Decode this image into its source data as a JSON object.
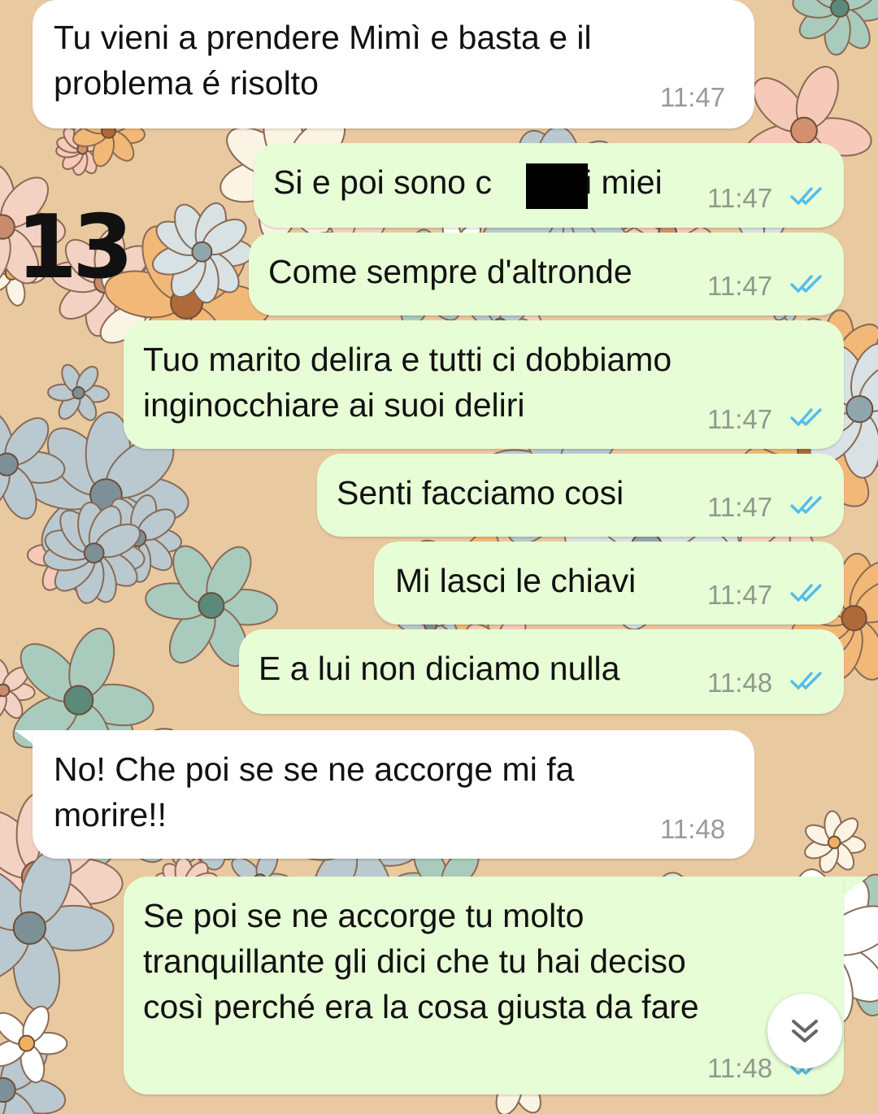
{
  "annotation": {
    "number": "13"
  },
  "messages": [
    {
      "dir": "in",
      "text": "Tu vieni a prendere Mimì e basta e il\nproblema é risolto",
      "time": "11:47"
    },
    {
      "dir": "out",
      "text_before": "Si e poi sono c",
      "text_after": "i miei",
      "time": "11:47",
      "redacted": true
    },
    {
      "dir": "out",
      "text": "Come sempre d'altronde",
      "time": "11:47"
    },
    {
      "dir": "out",
      "text": "Tuo marito delira e tutti ci dobbiamo\ninginocchiare ai suoi deliri",
      "time": "11:47"
    },
    {
      "dir": "out",
      "text": "Senti facciamo cosi",
      "time": "11:47"
    },
    {
      "dir": "out",
      "text": "Mi lasci le chiavi",
      "time": "11:47"
    },
    {
      "dir": "out",
      "text": "E a lui non diciamo nulla",
      "time": "11:48"
    },
    {
      "dir": "in",
      "text": "No! Che poi se se ne accorge mi fa\nmorire!!",
      "time": "11:48"
    },
    {
      "dir": "out",
      "text": "Se poi se ne accorge tu molto\ntranquillante gli dici che tu hai deciso\ncosì perché era la cosa giusta da fare",
      "time": "11:48"
    }
  ],
  "colors": {
    "incoming_bubble": "#ffffff",
    "outgoing_bubble": "#e7fdd6",
    "read_ticks": "#53bdeb",
    "wallpaper_base": "#e9c9a0"
  },
  "icons": {
    "scroll_down": "double-chevron-down-icon",
    "read_receipt": "double-check-icon"
  }
}
